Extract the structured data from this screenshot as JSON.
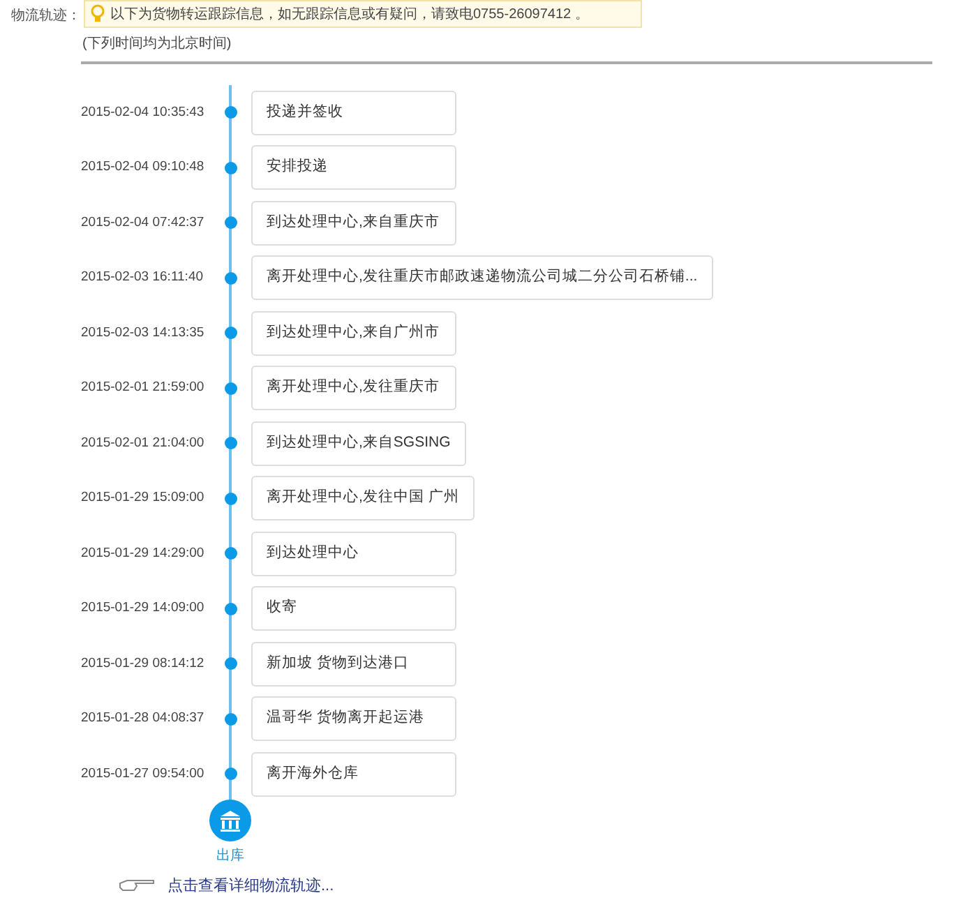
{
  "label": "物流轨迹：",
  "notice": "以下为货物转运跟踪信息，如无跟踪信息或有疑问，请致电0755-26097412 。",
  "note": "(下列时间均为北京时间)",
  "events": [
    {
      "time": "2015-02-04 10:35:43",
      "text": "投递并签收"
    },
    {
      "time": "2015-02-04 09:10:48",
      "text": "安排投递"
    },
    {
      "time": "2015-02-04 07:42:37",
      "text": "到达处理中心,来自重庆市"
    },
    {
      "time": "2015-02-03 16:11:40",
      "text": "离开处理中心,发往重庆市邮政速递物流公司城二分公司石桥铺..."
    },
    {
      "time": "2015-02-03 14:13:35",
      "text": "到达处理中心,来自广州市"
    },
    {
      "time": "2015-02-01 21:59:00",
      "text": "离开处理中心,发往重庆市"
    },
    {
      "time": "2015-02-01 21:04:00",
      "text": "到达处理中心,来自SGSING"
    },
    {
      "time": "2015-01-29 15:09:00",
      "text": "离开处理中心,发往中国 广州"
    },
    {
      "time": "2015-01-29 14:29:00",
      "text": "到达处理中心"
    },
    {
      "time": "2015-01-29 14:09:00",
      "text": "收寄"
    },
    {
      "time": "2015-01-29 08:14:12",
      "text": "新加坡 货物到达港口"
    },
    {
      "time": "2015-01-28 04:08:37",
      "text": "温哥华 货物离开起运港"
    },
    {
      "time": "2015-01-27 09:54:00",
      "text": "离开海外仓库"
    }
  ],
  "end_label": "出库",
  "link": "点击查看详细物流轨迹..."
}
